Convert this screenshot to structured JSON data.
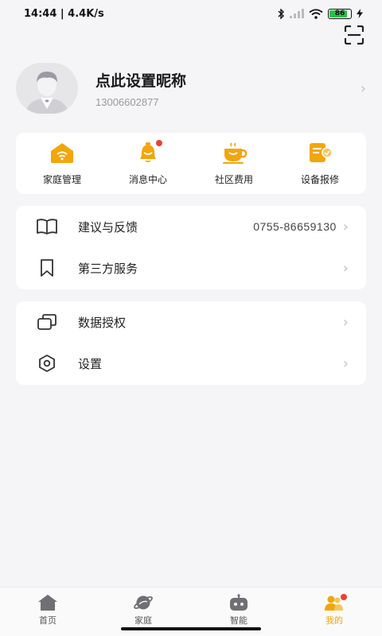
{
  "status_bar": {
    "time_speed": "14:44 | 4.4K/s",
    "battery": "86",
    "battery_level_percent": 86
  },
  "profile": {
    "nickname": "点此设置昵称",
    "phone": "13006602877"
  },
  "quick_actions": [
    {
      "label": "家庭管理",
      "icon": "home-wifi-icon"
    },
    {
      "label": "消息中心",
      "icon": "bell-icon"
    },
    {
      "label": "社区费用",
      "icon": "cup-icon"
    },
    {
      "label": "设备报修",
      "icon": "repair-note-icon"
    }
  ],
  "menu_group_1": [
    {
      "label": "建议与反馈",
      "value": "0755-86659130",
      "icon": "book-icon"
    },
    {
      "label": "第三方服务",
      "value": "",
      "icon": "bookmark-icon"
    }
  ],
  "menu_group_2": [
    {
      "label": "数据授权",
      "icon": "stacked-windows-icon"
    },
    {
      "label": "设置",
      "icon": "hexagon-settings-icon"
    }
  ],
  "tabs": [
    {
      "label": "首页",
      "active": false
    },
    {
      "label": "家庭",
      "active": false
    },
    {
      "label": "智能",
      "active": false
    },
    {
      "label": "我的",
      "active": true
    }
  ],
  "colors": {
    "accent": "#f3a60b",
    "badge": "#e8432f",
    "background": "#f5f5f7"
  },
  "chevron": "›"
}
